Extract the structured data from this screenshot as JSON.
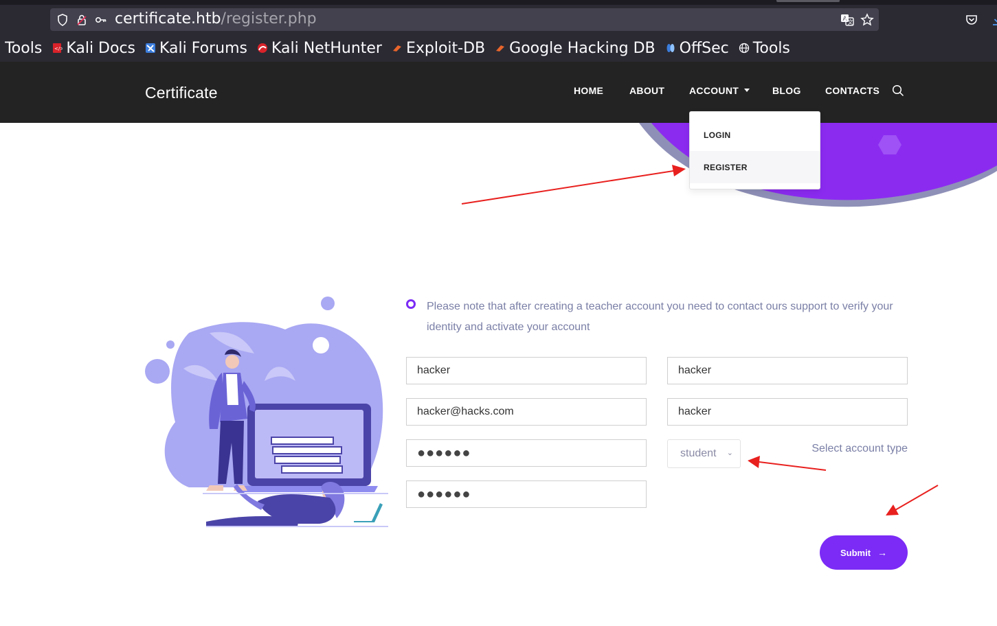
{
  "browser": {
    "url_host": "certificate.htb",
    "url_path": "/register.php",
    "bookmarks": [
      {
        "label": "i Tools",
        "favicon_color": "#2b2a33"
      },
      {
        "label": "Kali Docs",
        "favicon_color": "#d9222a"
      },
      {
        "label": "Kali Forums",
        "favicon_color": "#3b7ddd"
      },
      {
        "label": "Kali NetHunter",
        "favicon_color": "#d9222a"
      },
      {
        "label": "Exploit-DB",
        "favicon_color": "#e8652b"
      },
      {
        "label": "Google Hacking DB",
        "favicon_color": "#e8652b"
      },
      {
        "label": "OffSec",
        "favicon_color": "#3b7ddd"
      },
      {
        "label": "Tools",
        "favicon_color": "#fbfbfe"
      }
    ]
  },
  "site": {
    "brand": "Certificate",
    "nav": {
      "home": "HOME",
      "about": "ABOUT",
      "account": "ACCOUNT",
      "blog": "BLOG",
      "contacts": "CONTACTS"
    },
    "dropdown": {
      "login": "LOGIN",
      "register": "REGISTER"
    },
    "accent_color": "#7b2bf5"
  },
  "form": {
    "notice": "Please note that after creating a teacher account you need to contact ours support to verify your identity and activate your account",
    "first_name": "hacker",
    "last_name": "hacker",
    "email": "hacker@hacks.com",
    "username": "hacker",
    "password_mask": "●●●●●●",
    "confirm_password_mask": "●●●●●●",
    "account_type": "student",
    "account_type_label": "Select account type",
    "submit_label": "Submit",
    "submit_arrow": "→"
  }
}
